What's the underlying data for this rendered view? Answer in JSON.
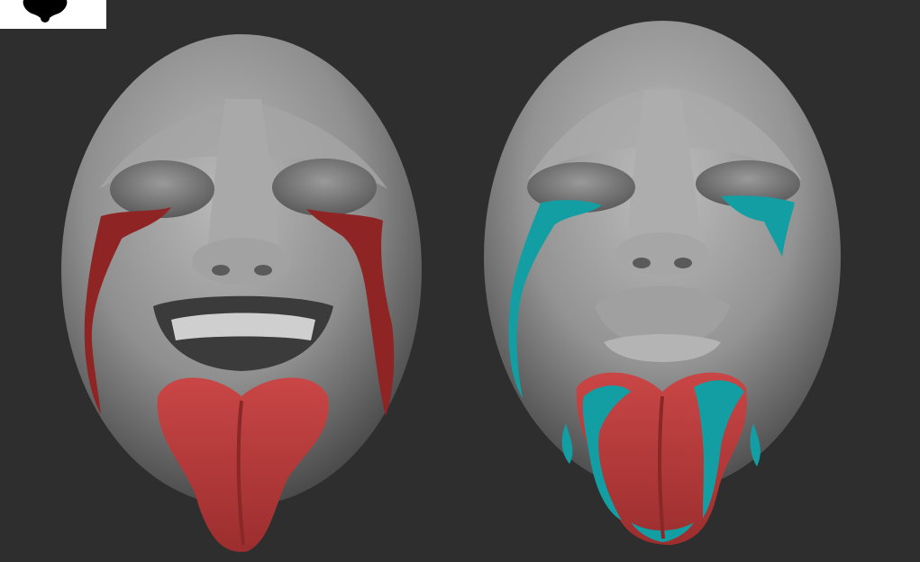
{
  "scene": {
    "background_color": "#2e2e2e",
    "clay_color": "#8a8a8a",
    "left_mask": {
      "tears_color": "#8e2424",
      "tongue_color": "#b33a3a",
      "expression": "grimace-with-tongue-out"
    },
    "right_mask": {
      "tears_color": "#139ea3",
      "tongue_color": "#b33a3a",
      "expression": "crying-pout-with-tongue-out"
    }
  },
  "logo": {
    "icon": "black-blob-icon",
    "background_color": "#ffffff"
  }
}
